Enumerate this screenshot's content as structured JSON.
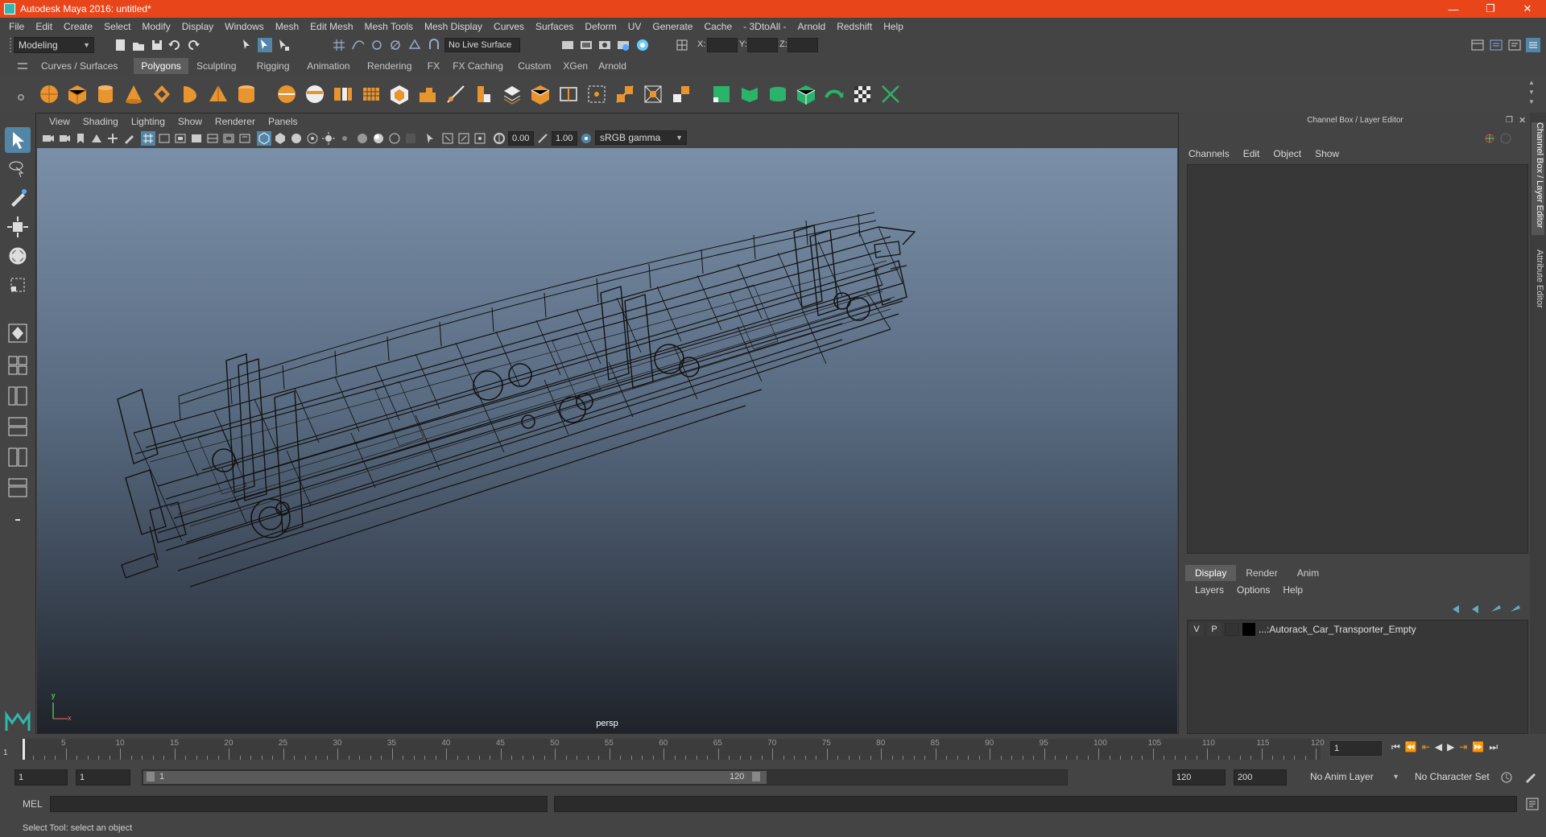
{
  "window": {
    "title": "Autodesk Maya 2016: untitled*"
  },
  "menubar": [
    "File",
    "Edit",
    "Create",
    "Select",
    "Modify",
    "Display",
    "Windows",
    "Mesh",
    "Edit Mesh",
    "Mesh Tools",
    "Mesh Display",
    "Curves",
    "Surfaces",
    "Deform",
    "UV",
    "Generate",
    "Cache",
    "- 3DtoAll -",
    "Arnold",
    "Redshift",
    "Help"
  ],
  "statusline": {
    "mode": "Modeling",
    "live_surface": "No Live Surface",
    "x_label": "X:",
    "y_label": "Y:",
    "z_label": "Z:"
  },
  "shelf_tabs": [
    "Curves / Surfaces",
    "Polygons",
    "Sculpting",
    "Rigging",
    "Animation",
    "Rendering",
    "FX",
    "FX Caching",
    "Custom",
    "XGen",
    "Arnold"
  ],
  "shelf_active": "Polygons",
  "viewport": {
    "menus": [
      "View",
      "Shading",
      "Lighting",
      "Show",
      "Renderer",
      "Panels"
    ],
    "exposure": "0.00",
    "gamma": "1.00",
    "colorspace": "sRGB gamma",
    "camera": "persp",
    "axis_y": "y",
    "axis_x": "x"
  },
  "right_panel": {
    "header": "Channel Box / Layer Editor",
    "cb_menu": [
      "Channels",
      "Edit",
      "Object",
      "Show"
    ],
    "le_tabs": [
      "Display",
      "Render",
      "Anim"
    ],
    "le_active": "Display",
    "le_menu": [
      "Layers",
      "Options",
      "Help"
    ],
    "layer": {
      "v": "V",
      "p": "P",
      "name": "...:Autorack_Car_Transporter_Empty"
    }
  },
  "side_tabs": [
    "Channel Box / Layer Editor",
    "Attribute Editor"
  ],
  "timeslider": {
    "ticks": [
      "5",
      "10",
      "15",
      "20",
      "25",
      "30",
      "35",
      "40",
      "45",
      "50",
      "55",
      "60",
      "65",
      "70",
      "75",
      "80",
      "85",
      "90",
      "95",
      "100",
      "105",
      "110",
      "115",
      "120"
    ],
    "start_label": "1",
    "current_frame": "1"
  },
  "range": {
    "start": "1",
    "inner_start": "1",
    "slider_start": "1",
    "slider_end": "120",
    "end": "120",
    "max": "200",
    "anim_layer": "No Anim Layer",
    "char_set": "No Character Set"
  },
  "cmdline": {
    "label": "MEL"
  },
  "helpline": {
    "text": "Select Tool: select an object"
  }
}
